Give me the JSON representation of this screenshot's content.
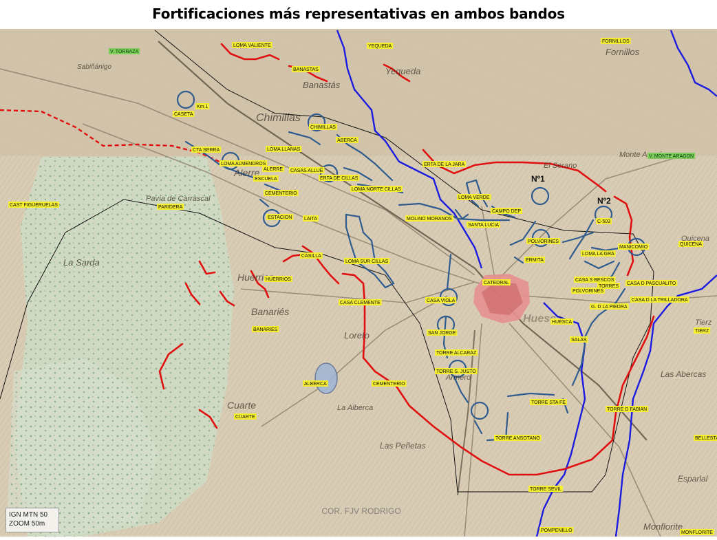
{
  "title": "Fortificaciones más representativas en ambos bandos",
  "credit": "COR. FJV RODRIGO",
  "scale": {
    "line1": "IGN MTN 50",
    "line2": "ZOOM 50m"
  },
  "colors": {
    "republican_line": "#e01010",
    "nationalist_positions": "#2f5b8f",
    "river": "#1a1ae0",
    "label_bg": "#f5ee30",
    "map_base": "#d6cbb2",
    "green_area": "#c9dcc2"
  },
  "sectors": {
    "n1": "Nº1",
    "n2": "Nº2"
  },
  "place_names": [
    "Chimillas",
    "Alerre",
    "Banastás",
    "Yequeda",
    "Fornillos",
    "Huerrios",
    "Banariés",
    "Cuarte",
    "Loreto",
    "Huesca",
    "Las Abercas",
    "Esparlal",
    "Monflorite",
    "La Sarda",
    "Pavía de Carrascal",
    "Tierz",
    "Quicena",
    "Sabiñánigo",
    "Las Peñetas",
    "El Serano",
    "Monte Aragón",
    "Armero",
    "La Alberca"
  ],
  "labels": [
    {
      "text": "V. TORRAZA",
      "color": "green"
    },
    {
      "text": "LOMA VALIENTE",
      "color": "yellow"
    },
    {
      "text": "YEQUEDA",
      "color": "yellow"
    },
    {
      "text": "FORNILLOS",
      "color": "yellow"
    },
    {
      "text": "BANASTAS",
      "color": "yellow"
    },
    {
      "text": "Km.1",
      "color": "yellow"
    },
    {
      "text": "CASETA",
      "color": "yellow"
    },
    {
      "text": "CHIMILLAS",
      "color": "yellow"
    },
    {
      "text": "ABERCA",
      "color": "yellow"
    },
    {
      "text": "CTA SERRA",
      "color": "yellow"
    },
    {
      "text": "LOMA LLANAS",
      "color": "yellow"
    },
    {
      "text": "V. MONTE ARAGON",
      "color": "green"
    },
    {
      "text": "LOMA ALMENDROS",
      "color": "yellow"
    },
    {
      "text": "ALERRE",
      "color": "yellow"
    },
    {
      "text": "CASAS ALLUE",
      "color": "yellow"
    },
    {
      "text": "ERTA DE CILLAS",
      "color": "yellow"
    },
    {
      "text": "ERTA DE LA JARA",
      "color": "yellow"
    },
    {
      "text": "ESCUELA",
      "color": "yellow"
    },
    {
      "text": "LOMA NORTE CILLAS",
      "color": "yellow"
    },
    {
      "text": "CEMENTERIO",
      "color": "yellow"
    },
    {
      "text": "LOMA VERDE",
      "color": "yellow"
    },
    {
      "text": "CAST FIGUERUELAS",
      "color": "yellow"
    },
    {
      "text": "PARIDERA",
      "color": "yellow"
    },
    {
      "text": "CAMPO DEP",
      "color": "yellow"
    },
    {
      "text": "ESTACION",
      "color": "yellow"
    },
    {
      "text": "LAITA",
      "color": "yellow"
    },
    {
      "text": "MOLINO MORANOS",
      "color": "yellow"
    },
    {
      "text": "SANTA LUCIA",
      "color": "yellow"
    },
    {
      "text": "C-503",
      "color": "yellow"
    },
    {
      "text": "POLVORINES",
      "color": "yellow"
    },
    {
      "text": "MANICOMIO",
      "color": "yellow"
    },
    {
      "text": "QUICENA",
      "color": "yellow"
    },
    {
      "text": "CASILLA",
      "color": "yellow"
    },
    {
      "text": "LOMA SUR CILLAS",
      "color": "yellow"
    },
    {
      "text": "ERMITA",
      "color": "yellow"
    },
    {
      "text": "LOMA LA GRA",
      "color": "yellow"
    },
    {
      "text": "HUERRIOS",
      "color": "yellow"
    },
    {
      "text": "CATEDRAL",
      "color": "yellow"
    },
    {
      "text": "CASA S BESCOS",
      "color": "yellow"
    },
    {
      "text": "TORRES",
      "color": "yellow"
    },
    {
      "text": "CASA D PASCUALITO",
      "color": "yellow"
    },
    {
      "text": "POLVORINES",
      "color": "yellow"
    },
    {
      "text": "CASA CLEMENTE",
      "color": "yellow"
    },
    {
      "text": "CASA VIOLA",
      "color": "yellow"
    },
    {
      "text": "G. D LA PIEDRA",
      "color": "yellow"
    },
    {
      "text": "CASA D LA TRILLADORA",
      "color": "yellow"
    },
    {
      "text": "HUESCA",
      "color": "yellow"
    },
    {
      "text": "BANARIES",
      "color": "yellow"
    },
    {
      "text": "SAN JORGE",
      "color": "yellow"
    },
    {
      "text": "SALAS",
      "color": "yellow"
    },
    {
      "text": "TIERZ",
      "color": "yellow"
    },
    {
      "text": "TORRE ALCARAZ",
      "color": "yellow"
    },
    {
      "text": "TORRE S. JUSTO",
      "color": "yellow"
    },
    {
      "text": "ALBERCA",
      "color": "yellow"
    },
    {
      "text": "CEMENTERIO",
      "color": "yellow"
    },
    {
      "text": "TORRE STA FE",
      "color": "yellow"
    },
    {
      "text": "CUARTE",
      "color": "yellow"
    },
    {
      "text": "TORRE D FABIAN",
      "color": "yellow"
    },
    {
      "text": "TORRE ANSOTANO",
      "color": "yellow"
    },
    {
      "text": "BELLESTAR",
      "color": "yellow"
    },
    {
      "text": "TORRE SEVIL",
      "color": "yellow"
    },
    {
      "text": "POMPENILLO",
      "color": "yellow"
    },
    {
      "text": "MONFLORITE",
      "color": "yellow"
    }
  ]
}
